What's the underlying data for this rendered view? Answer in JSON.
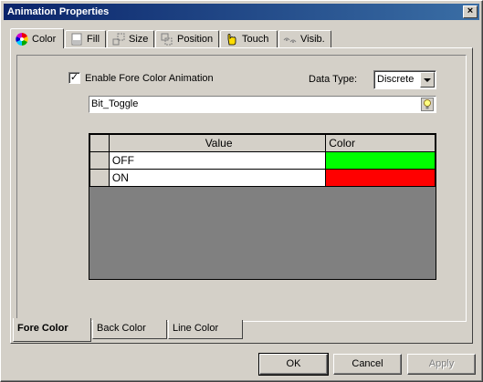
{
  "window": {
    "title": "Animation Properties",
    "close_glyph": "×"
  },
  "tabs": [
    {
      "label": "Color",
      "icon": "color-wheel-icon"
    },
    {
      "label": "Fill",
      "icon": "fill-icon"
    },
    {
      "label": "Size",
      "icon": "size-icon"
    },
    {
      "label": "Position",
      "icon": "position-icon"
    },
    {
      "label": "Touch",
      "icon": "hand-icon"
    },
    {
      "label": "Visib.",
      "icon": "visibility-icon"
    }
  ],
  "color_tab": {
    "enable_label": "Enable Fore Color Animation",
    "enable_checked": true,
    "check_glyph": "✓",
    "data_type_label": "Data Type:",
    "data_type_value": "Discrete",
    "tag_value": "Bit_Toggle",
    "grid": {
      "columns": [
        "Value",
        "Color"
      ],
      "rows": [
        {
          "value": "OFF",
          "color": "#00ff00"
        },
        {
          "value": "ON",
          "color": "#ff0000"
        }
      ]
    }
  },
  "subtabs": [
    {
      "label": "Fore Color",
      "active": true
    },
    {
      "label": "Back Color",
      "active": false
    },
    {
      "label": "Line Color",
      "active": false
    }
  ],
  "buttons": {
    "ok": "OK",
    "cancel": "Cancel",
    "apply": "Apply"
  }
}
